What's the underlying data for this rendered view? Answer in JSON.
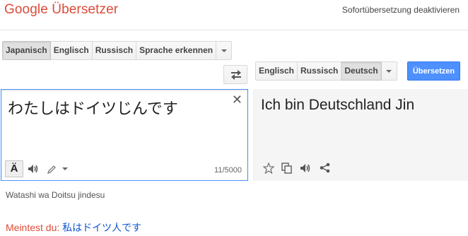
{
  "header": {
    "logo": "Google Übersetzer",
    "instant_toggle": "Sofortübersetzung deaktivieren"
  },
  "source_langs": [
    "Japanisch",
    "Englisch",
    "Russisch",
    "Sprache erkennen"
  ],
  "source_selected": "Japanisch",
  "target_langs": [
    "Englisch",
    "Russisch",
    "Deutsch"
  ],
  "target_selected": "Deutsch",
  "translate_button": "Übersetzen",
  "source": {
    "text": "わたしはドイツじんです",
    "char_count": "11/5000",
    "keyboard_label": "Ä"
  },
  "target": {
    "text": "Ich bin Deutschland Jin"
  },
  "transliteration": "Watashi wa Doitsu jindesu",
  "did_you_mean": {
    "label": "Meintest du:",
    "suggestion": "私はドイツ人です"
  },
  "colors": {
    "logo": "#dd4b39",
    "accent_blue": "#4d90fe",
    "suggestion_link": "#1155cc"
  }
}
